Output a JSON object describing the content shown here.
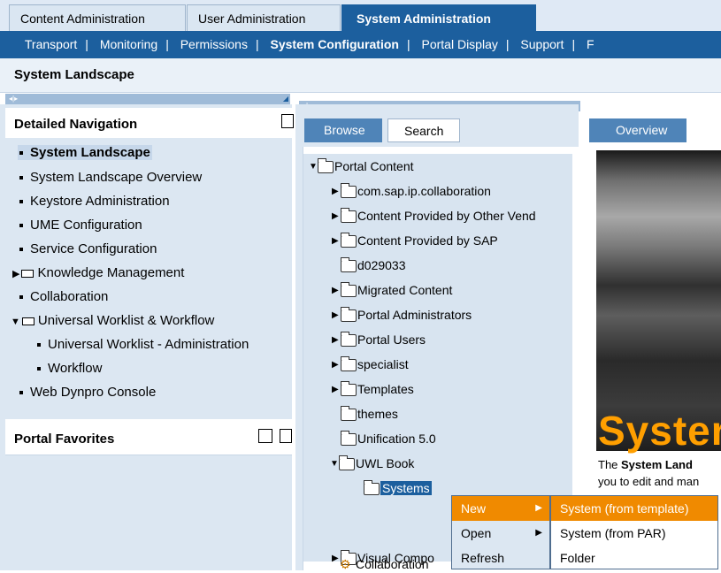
{
  "top_tabs": [
    "Content Administration",
    "User Administration",
    "System Administration"
  ],
  "sub_nav": [
    "Transport",
    "Monitoring",
    "Permissions",
    "System Configuration",
    "Portal Display",
    "Support",
    "F"
  ],
  "page_title": "System Landscape",
  "detailed_navigation": {
    "title": "Detailed Navigation",
    "items": [
      {
        "label": "System Landscape"
      },
      {
        "label": "System Landscape Overview"
      },
      {
        "label": "Keystore Administration"
      },
      {
        "label": "UME Configuration"
      },
      {
        "label": "Service Configuration"
      },
      {
        "label": "Knowledge Management"
      },
      {
        "label": "Collaboration"
      },
      {
        "label": "Universal Worklist & Workflow"
      },
      {
        "label": "Universal Worklist - Administration"
      },
      {
        "label": "Workflow"
      },
      {
        "label": "Web Dynpro Console"
      }
    ]
  },
  "portal_favorites": {
    "title": "Portal Favorites"
  },
  "browser_tabs": [
    "Browse",
    "Search"
  ],
  "tree": [
    "Portal Content",
    "com.sap.ip.collaboration",
    "Content Provided by Other Vend",
    "Content Provided by SAP",
    "d029033",
    "Migrated Content",
    "Portal Administrators",
    "Portal Users",
    "specialist",
    "Templates",
    "themes",
    "Unification 5.0",
    "UWL Book",
    "Systems",
    "Visual Compo",
    "Collaboration"
  ],
  "overview": {
    "tab": "Overview",
    "banner": "Syster",
    "text_prefix": "The ",
    "text_bold": "System Land",
    "text_line2": "you to edit and man"
  },
  "context_menu": {
    "items": [
      "New",
      "Open",
      "Refresh"
    ],
    "submenu": [
      "System (from template)",
      "System (from PAR)",
      "Folder"
    ]
  },
  "colors": {
    "brand_blue": "#1c5f9e",
    "highlight_orange": "#f08a00",
    "panel_bg": "#dce7f2"
  }
}
